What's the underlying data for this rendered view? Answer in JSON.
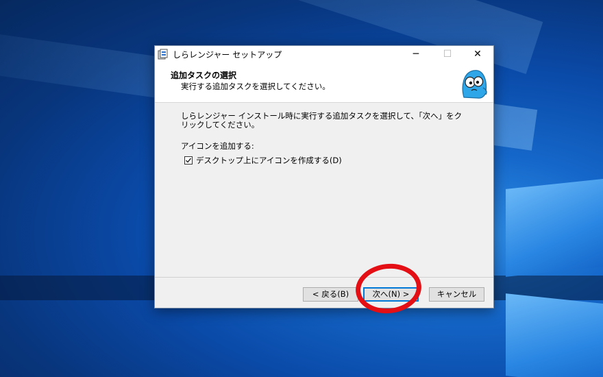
{
  "window": {
    "title": "しらレンジャー セットアップ",
    "minimize_symbol": "─",
    "maximize_symbol": "☐",
    "close_symbol": "✕"
  },
  "header": {
    "title": "追加タスクの選択",
    "subtitle": "実行する追加タスクを選択してください。"
  },
  "body": {
    "description": "しらレンジャー インストール時に実行する追加タスクを選択して、「次へ」をクリックしてください。",
    "section_label": "アイコンを追加する:",
    "checkbox": {
      "label": "デスクトップ上にアイコンを作成する(D)",
      "checked": true
    }
  },
  "buttons": {
    "back": "< 戻る(B)",
    "next": "次へ(N) >",
    "cancel": "キャンセル"
  },
  "colors": {
    "accent": "#0078d7",
    "highlight_ring": "#e30f14"
  },
  "icons": {
    "app": "installer-app-icon",
    "mascot": "mascot-character-icon",
    "check": "checkmark-icon"
  }
}
